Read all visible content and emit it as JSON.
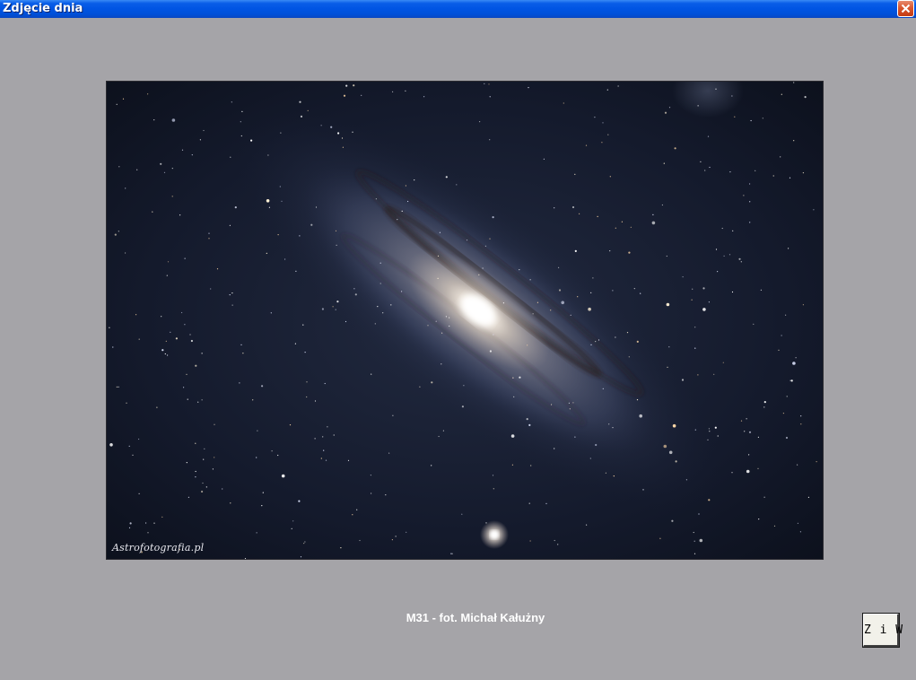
{
  "window": {
    "title": "Zdjęcie dnia",
    "close_icon": "close-icon"
  },
  "photo": {
    "watermark": "Astrofotografia.pl",
    "caption": "M31 - fot. Michał Kałużny"
  },
  "actions": {
    "ziw_label": "Z i W"
  },
  "colors": {
    "background": "#a5a4a8",
    "titlebar": "#0054e3",
    "close_button": "#d9572f",
    "caption_text": "#ffffff"
  }
}
